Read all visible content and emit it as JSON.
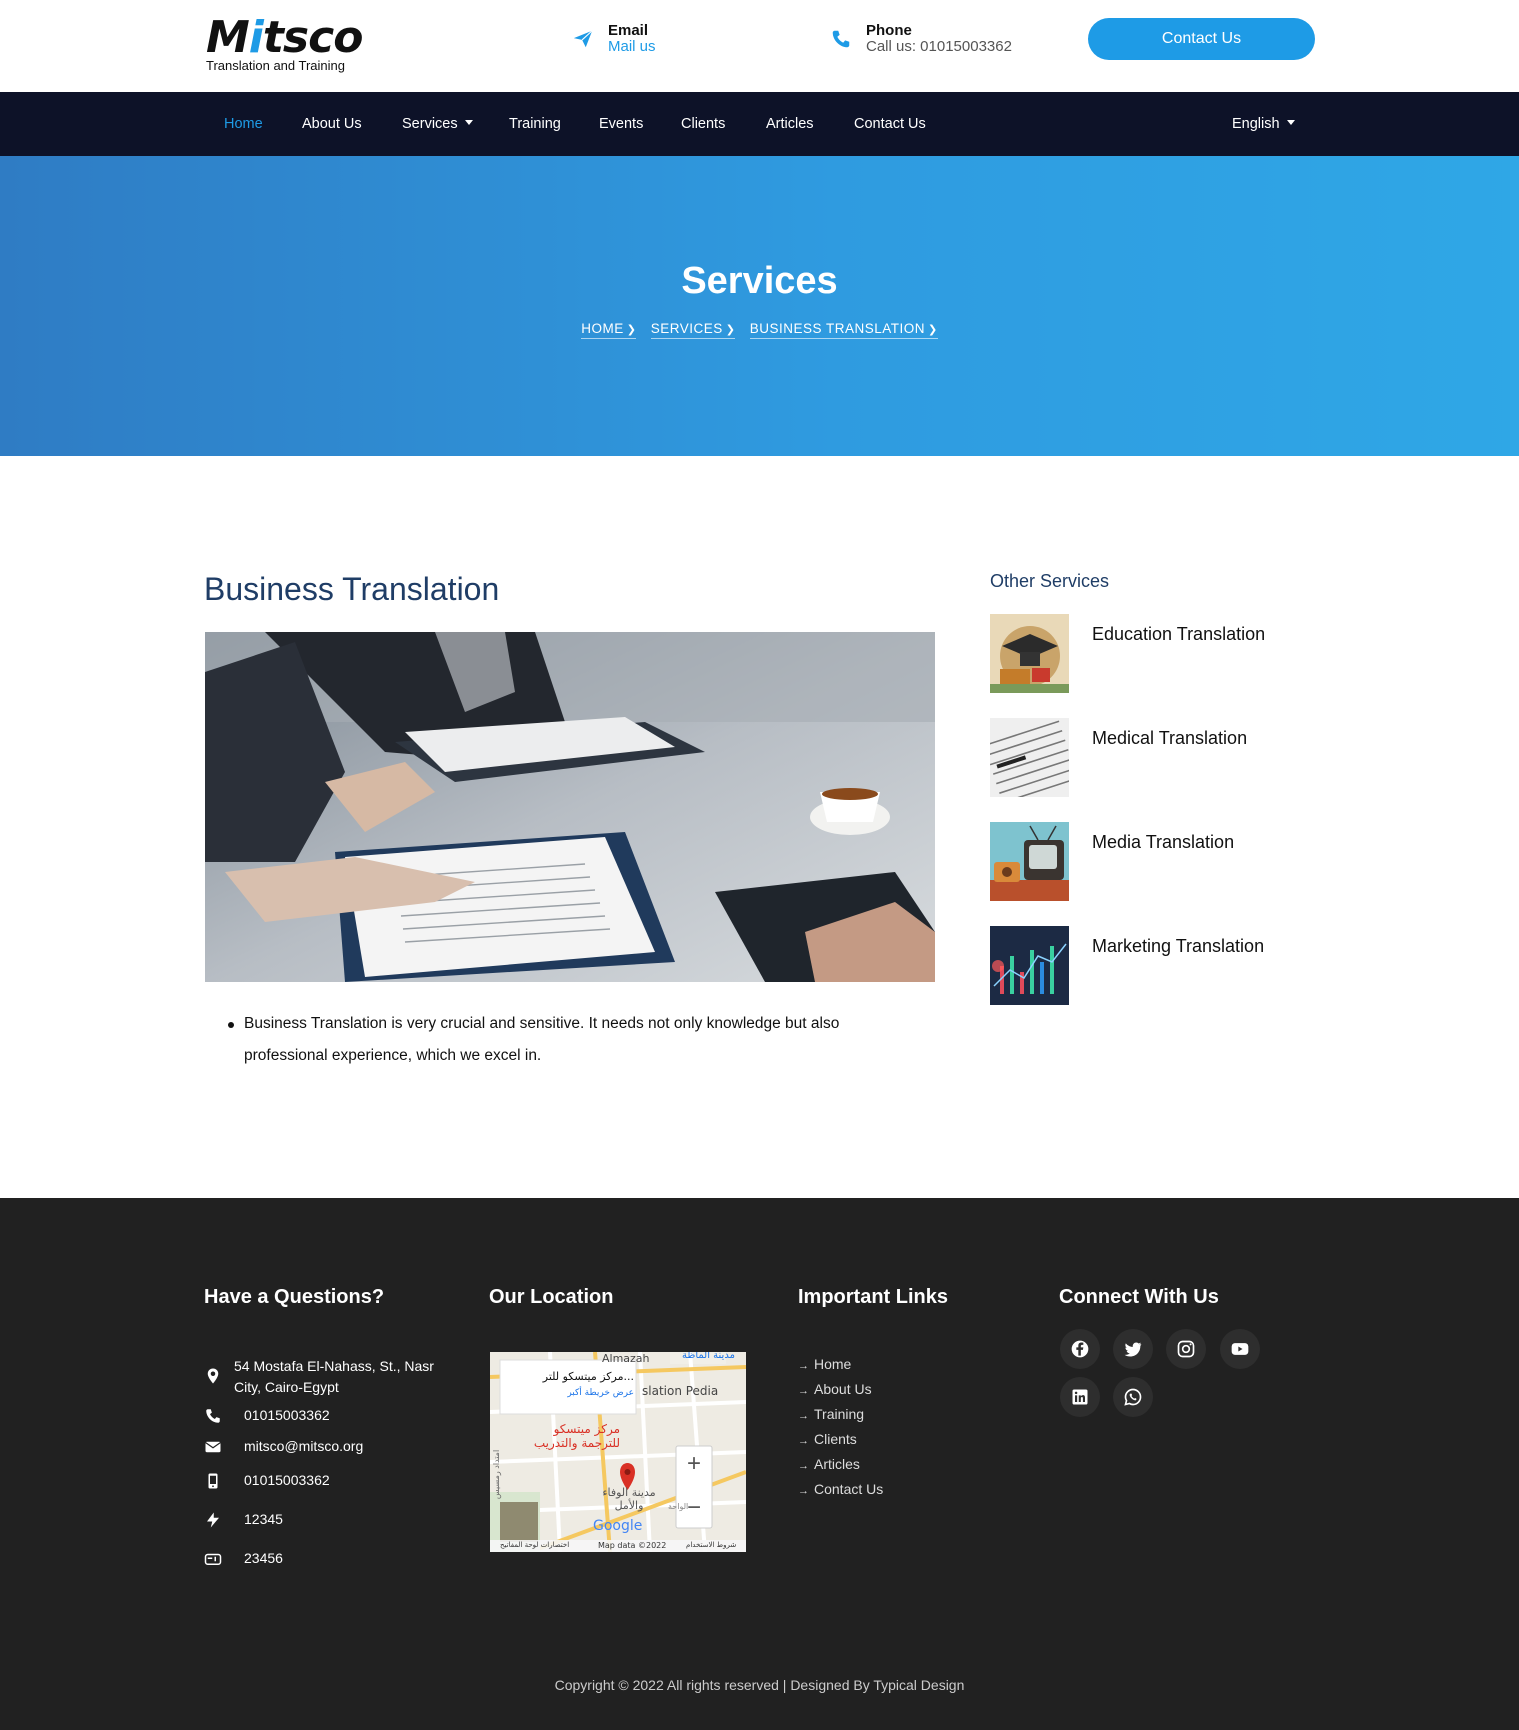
{
  "logo": {
    "brand_word": "Mitsco",
    "tagline": "Translation and Training"
  },
  "header": {
    "email_label": "Email",
    "email_value": "Mail us",
    "phone_label": "Phone",
    "phone_value": "Call us: 01015003362",
    "contact_button": "Contact Us"
  },
  "nav": {
    "items": [
      "Home",
      "About Us",
      "Services",
      "Training",
      "Events",
      "Clients",
      "Articles",
      "Contact Us"
    ],
    "language": "English"
  },
  "hero": {
    "title": "Services",
    "breadcrumb": [
      "HOME",
      "SERVICES",
      "BUSINESS TRANSLATION"
    ]
  },
  "main": {
    "title": "Business Translation",
    "description": "Business Translation is very crucial and sensitive. It needs not only knowledge but also professional experience,  which we excel in."
  },
  "sidebar": {
    "title": "Other Services",
    "items": [
      "Education Translation",
      "Medical Translation",
      "Media Translation",
      "Marketing Translation"
    ]
  },
  "footer": {
    "questions_title": "Have a Questions?",
    "location_title": "Our Location",
    "links_title": "Important Links",
    "connect_title": "Connect With Us",
    "address": "54 Mostafa El-Nahass, St., Nasr City, Cairo-Egypt",
    "phone": "01015003362",
    "email": "mitsco@mitsco.org",
    "mobile": "01015003362",
    "fax": "12345",
    "pobox": "23456",
    "links": [
      "Home",
      "About Us",
      "Training",
      "Clients",
      "Articles",
      "Contact Us"
    ],
    "social": [
      "facebook-icon",
      "twitter-icon",
      "instagram-icon",
      "youtube-icon",
      "linkedin-icon",
      "whatsapp-icon"
    ],
    "copyright": "Copyright © 2022 All rights reserved | Designed By Typical Design"
  },
  "map": {
    "place_name": "مركز ميتسكو للتر...",
    "view_larger": "عرض خريطة أكبر",
    "pin_label_line1": "مركز ميتسكو",
    "pin_label_line2": "للترجمة والتدريب",
    "area_top": "Almazah",
    "area_top_ar": "مدينة الماظة",
    "area_right": "slation Pedia",
    "area_bottom_line1": "مدينة الوفاء",
    "area_bottom_line2": "والأمل",
    "area_small": "الواحة",
    "area_left": "امتداد رمسيس",
    "google": "Google",
    "shortcuts": "اختصارات لوحة المفاتيح",
    "map_data": "Map data ©2022",
    "terms": "شروط الاستخدام"
  },
  "colors": {
    "accent": "#1e9be6",
    "nav_bg": "#0d1228",
    "footer_bg": "#212121",
    "heading": "#1f3d66"
  }
}
